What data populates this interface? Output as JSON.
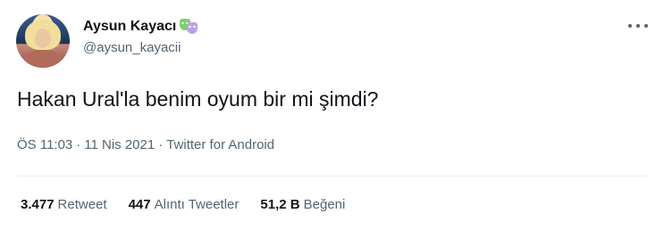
{
  "user": {
    "display_name": "Aysun Kayacı",
    "handle": "@aysun_kayacii",
    "badge_icon": "performing-arts-emoji"
  },
  "tweet": {
    "text": "Hakan Ural'la benim oyum bir mi şimdi?",
    "time": "ÖS 11:03",
    "date": "11 Nis 2021",
    "source": "Twitter for Android",
    "separator": "·"
  },
  "stats": {
    "retweets": {
      "value": "3.477",
      "label": "Retweet"
    },
    "quotes": {
      "value": "447",
      "label": "Alıntı Tweetler"
    },
    "likes": {
      "value": "51,2 B",
      "label": "Beğeni"
    }
  },
  "colors": {
    "text_primary": "#0f1419",
    "text_secondary": "#536471",
    "divider": "#eff3f4"
  }
}
